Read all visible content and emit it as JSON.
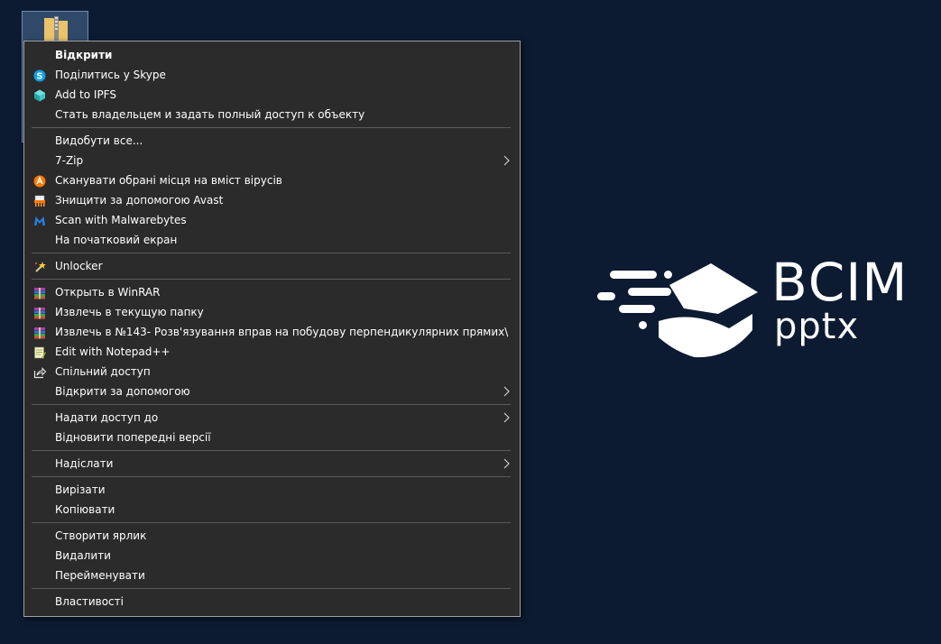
{
  "menu": {
    "groups": [
      [
        {
          "label": "Відкрити",
          "icon": "none",
          "bold": true
        },
        {
          "label": "Поділитись у Skype",
          "icon": "skype-icon"
        },
        {
          "label": "Add to IPFS",
          "icon": "ipfs-cube-icon"
        },
        {
          "label": "Стать владельцем и задать полный доступ к объекту",
          "icon": "none"
        }
      ],
      [
        {
          "label": "Видобути все...",
          "icon": "none"
        },
        {
          "label": "7-Zip",
          "icon": "none",
          "submenu": true
        },
        {
          "label": "Сканувати обрані місця на вміст вірусів",
          "icon": "avast-icon"
        },
        {
          "label": "Знищити за допомогою Avast",
          "icon": "avast-shredder-icon"
        },
        {
          "label": "Scan with Malwarebytes",
          "icon": "malwarebytes-icon"
        },
        {
          "label": "На початковий екран",
          "icon": "none"
        }
      ],
      [
        {
          "label": "Unlocker",
          "icon": "unlocker-wand-icon"
        }
      ],
      [
        {
          "label": "Открыть в WinRAR",
          "icon": "winrar-icon"
        },
        {
          "label": "Извлечь в текущую папку",
          "icon": "winrar-icon"
        },
        {
          "label": "Извлечь в №143- Розв'язування вправ на побудову перпендикулярних прямих\\",
          "icon": "winrar-icon"
        },
        {
          "label": "Edit with Notepad++",
          "icon": "notepadpp-icon"
        },
        {
          "label": "Спільний доступ",
          "icon": "share-icon"
        },
        {
          "label": "Відкрити за допомогою",
          "icon": "none",
          "submenu": true
        }
      ],
      [
        {
          "label": "Надати доступ до",
          "icon": "none",
          "submenu": true
        },
        {
          "label": "Відновити попередні версії",
          "icon": "none"
        }
      ],
      [
        {
          "label": "Надіслати",
          "icon": "none",
          "submenu": true
        }
      ],
      [
        {
          "label": "Вирізати",
          "icon": "none"
        },
        {
          "label": "Копіювати",
          "icon": "none"
        }
      ],
      [
        {
          "label": "Створити ярлик",
          "icon": "none"
        },
        {
          "label": "Видалити",
          "icon": "none"
        },
        {
          "label": "Перейменувати",
          "icon": "none"
        }
      ],
      [
        {
          "label": "Властивості",
          "icon": "none"
        }
      ]
    ]
  },
  "brand": {
    "name": "ВСІМ",
    "sub": "pptx"
  },
  "colors": {
    "desktop": "#0c1b32",
    "menu_bg": "#2b2b2b",
    "text": "#ffffff",
    "separator": "#5a5a5a"
  }
}
